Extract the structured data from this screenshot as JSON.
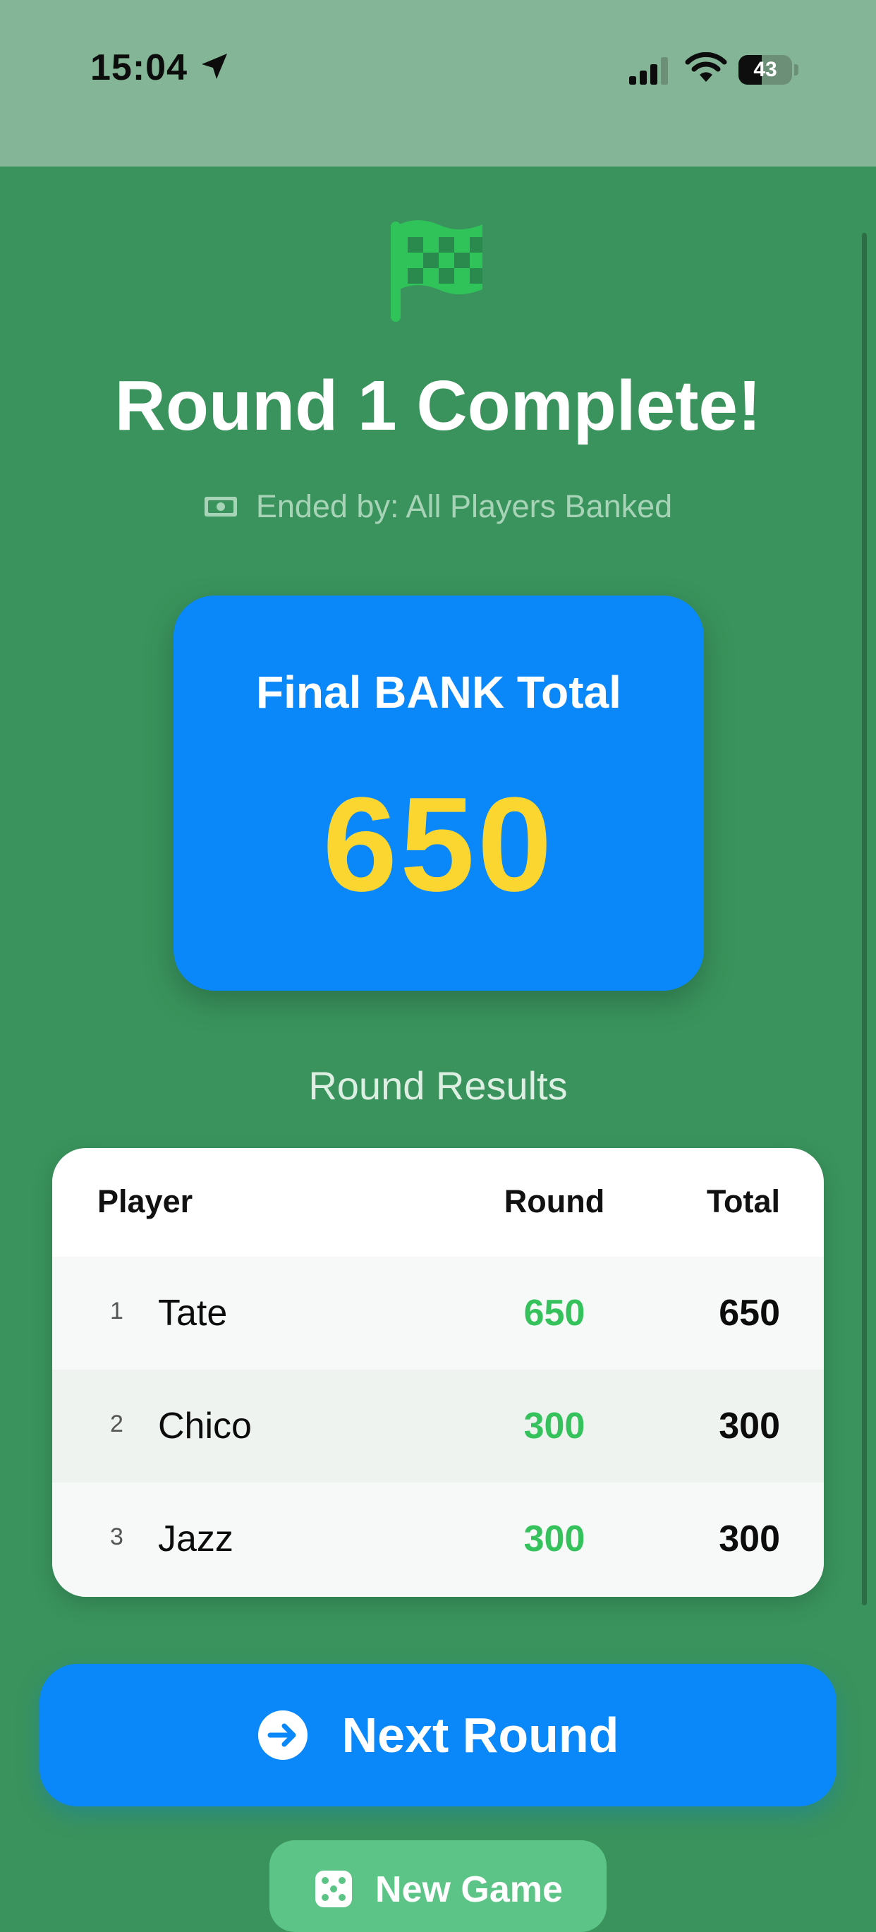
{
  "status_bar": {
    "time": "15:04",
    "battery_percent": "43",
    "battery_level": 0.43,
    "location_icon": "location-arrow-icon",
    "signal_icon": "cellular-signal-icon",
    "wifi_icon": "wifi-icon"
  },
  "header": {
    "icon": "checkered-flag-icon",
    "title": "Round 1 Complete!",
    "ended_icon": "cash-icon",
    "ended_text": "Ended by: All Players Banked"
  },
  "bank": {
    "label": "Final BANK Total",
    "value": "650"
  },
  "results": {
    "heading": "Round Results",
    "columns": {
      "player": "Player",
      "round": "Round",
      "total": "Total"
    },
    "rows": [
      {
        "rank": "1",
        "name": "Tate",
        "round": "650",
        "total": "650"
      },
      {
        "rank": "2",
        "name": "Chico",
        "round": "300",
        "total": "300"
      },
      {
        "rank": "3",
        "name": "Jazz",
        "round": "300",
        "total": "300"
      }
    ]
  },
  "actions": {
    "next_round_label": "Next Round",
    "next_round_icon": "arrow-right-circle-icon",
    "new_game_label": "New Game",
    "new_game_icon": "dice-icon"
  },
  "colors": {
    "background": "#3a935c",
    "accent_blue": "#0a88fa",
    "bank_value": "#fcd630",
    "round_points": "#35c25c",
    "flag_green": "#2fc35a"
  }
}
